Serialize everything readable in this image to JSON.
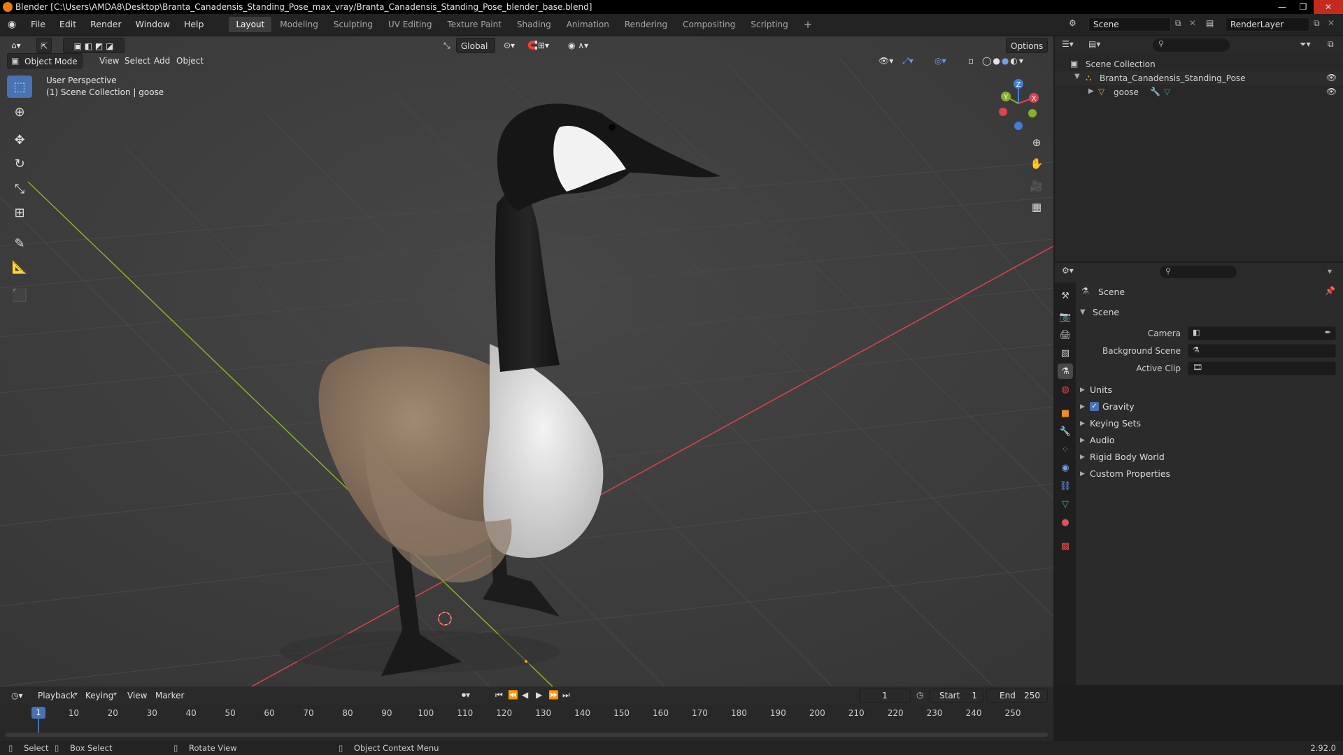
{
  "titlebar": {
    "title": "Blender [C:\\Users\\AMDA8\\Desktop\\Branta_Canadensis_Standing_Pose_max_vray/Branta_Canadensis_Standing_Pose_blender_base.blend]",
    "minimize": "—",
    "maximize": "❐",
    "close": "✕"
  },
  "menu": {
    "items": [
      "File",
      "Edit",
      "Render",
      "Window",
      "Help"
    ],
    "workspaces": [
      "Layout",
      "Modeling",
      "Sculpting",
      "UV Editing",
      "Texture Paint",
      "Shading",
      "Animation",
      "Rendering",
      "Compositing",
      "Scripting"
    ],
    "add_tab": "+",
    "scene_label": "Scene",
    "render_layer_label": "RenderLayer"
  },
  "viewport": {
    "mode": "Object Mode",
    "menus": [
      "View",
      "Select",
      "Add",
      "Object"
    ],
    "transform_orientation": "Global",
    "options_label": "Options",
    "overlay_line1": "User Perspective",
    "overlay_line2": "(1) Scene Collection | goose",
    "gizmo": {
      "x": "X",
      "y": "Y",
      "z": "Z"
    }
  },
  "outliner": {
    "root": "Scene Collection",
    "collection": "Branta_Canadensis_Standing_Pose",
    "object": "goose"
  },
  "properties": {
    "context": "Scene",
    "panel": "Scene",
    "fields": [
      {
        "label": "Camera"
      },
      {
        "label": "Background Scene"
      },
      {
        "label": "Active Clip"
      }
    ],
    "subpanels": [
      "Units",
      "Gravity",
      "Keying Sets",
      "Audio",
      "Rigid Body World",
      "Custom Properties"
    ],
    "gravity_checked": true
  },
  "timeline": {
    "menus": [
      "Playback",
      "Keying",
      "View",
      "Marker"
    ],
    "current_frame": "1",
    "start_label": "Start",
    "start_value": "1",
    "end_label": "End",
    "end_value": "250",
    "ticks": [
      "1",
      "10",
      "20",
      "30",
      "40",
      "50",
      "60",
      "70",
      "80",
      "90",
      "100",
      "110",
      "120",
      "130",
      "140",
      "150",
      "160",
      "170",
      "180",
      "190",
      "200",
      "210",
      "220",
      "230",
      "240",
      "250"
    ]
  },
  "statusbar": {
    "select": "Select",
    "box_select": "Box Select",
    "rotate_view": "Rotate View",
    "context_menu": "Object Context Menu",
    "version": "2.92.0"
  },
  "colors": {
    "accent": "#4772b3",
    "x_axis": "#d94451",
    "y_axis": "#89b02c",
    "z_axis": "#3f7fd6"
  }
}
